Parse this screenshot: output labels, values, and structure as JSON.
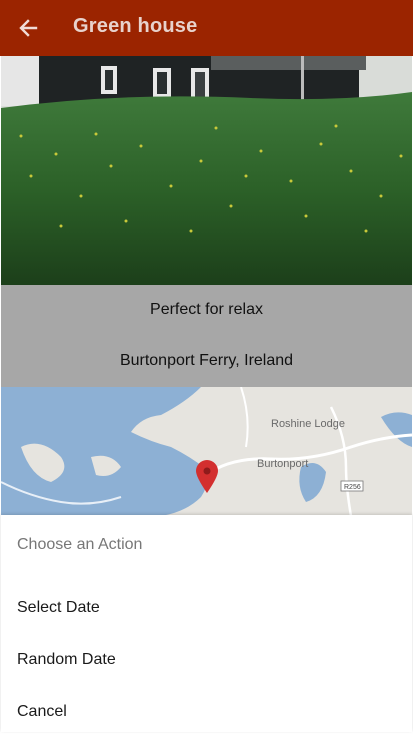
{
  "appbar": {
    "title": "Green house",
    "back_icon": "arrow-back-icon",
    "background": "#9b2400"
  },
  "photo": {
    "description_icon": "house-photo"
  },
  "info": {
    "tagline": "Perfect for relax",
    "location": "Burtonport Ferry, Ireland"
  },
  "map": {
    "labels": {
      "place1": "Roshine Lodge",
      "place2": "Burtonport",
      "road": "R256"
    },
    "marker_icon": "map-pin-icon",
    "marker_color": "#d32f2f"
  },
  "sheet": {
    "title": "Choose an Action",
    "items": [
      {
        "label": "Select Date"
      },
      {
        "label": "Random Date"
      },
      {
        "label": "Cancel"
      }
    ]
  }
}
